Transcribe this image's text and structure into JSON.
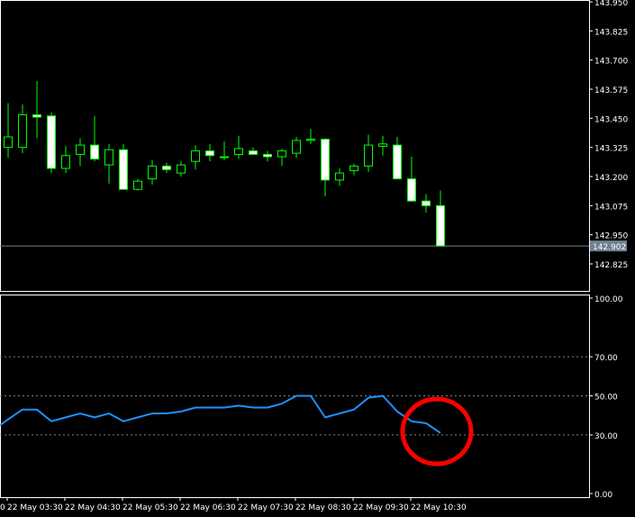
{
  "chart_data": [
    {
      "type": "candlestick",
      "title": "",
      "ylim": [
        142.77,
        143.96
      ],
      "y_ticks": [
        143.95,
        143.825,
        143.7,
        143.575,
        143.45,
        143.325,
        143.2,
        143.075,
        142.95,
        142.825
      ],
      "y_tick_labels": [
        "143.950",
        "143.825",
        "143.700",
        "143.575",
        "143.450",
        "143.325",
        "143.200",
        "143.075",
        "142.950",
        "142.825"
      ],
      "current_price": 142.902,
      "current_price_label": "142.902",
      "candles": [
        {
          "o": 143.325,
          "h": 143.515,
          "l": 143.28,
          "c": 143.37
        },
        {
          "o": 143.325,
          "h": 143.51,
          "l": 143.3,
          "c": 143.465
        },
        {
          "o": 143.465,
          "h": 143.61,
          "l": 143.365,
          "c": 143.455
        },
        {
          "o": 143.46,
          "h": 143.475,
          "l": 143.215,
          "c": 143.235
        },
        {
          "o": 143.235,
          "h": 143.33,
          "l": 143.215,
          "c": 143.29
        },
        {
          "o": 143.295,
          "h": 143.365,
          "l": 143.245,
          "c": 143.335
        },
        {
          "o": 143.335,
          "h": 143.46,
          "l": 143.265,
          "c": 143.275
        },
        {
          "o": 143.25,
          "h": 143.34,
          "l": 143.17,
          "c": 143.315
        },
        {
          "o": 143.315,
          "h": 143.34,
          "l": 143.145,
          "c": 143.145
        },
        {
          "o": 143.145,
          "h": 143.19,
          "l": 143.14,
          "c": 143.18
        },
        {
          "o": 143.19,
          "h": 143.27,
          "l": 143.165,
          "c": 143.245
        },
        {
          "o": 143.245,
          "h": 143.26,
          "l": 143.215,
          "c": 143.23
        },
        {
          "o": 143.215,
          "h": 143.265,
          "l": 143.2,
          "c": 143.25
        },
        {
          "o": 143.265,
          "h": 143.335,
          "l": 143.23,
          "c": 143.31
        },
        {
          "o": 143.31,
          "h": 143.34,
          "l": 143.265,
          "c": 143.29
        },
        {
          "o": 143.285,
          "h": 143.35,
          "l": 143.27,
          "c": 143.285
        },
        {
          "o": 143.295,
          "h": 143.375,
          "l": 143.275,
          "c": 143.32
        },
        {
          "o": 143.31,
          "h": 143.325,
          "l": 143.295,
          "c": 143.295
        },
        {
          "o": 143.295,
          "h": 143.31,
          "l": 143.265,
          "c": 143.285
        },
        {
          "o": 143.285,
          "h": 143.32,
          "l": 143.245,
          "c": 143.31
        },
        {
          "o": 143.3,
          "h": 143.37,
          "l": 143.28,
          "c": 143.355
        },
        {
          "o": 143.355,
          "h": 143.405,
          "l": 143.34,
          "c": 143.36
        },
        {
          "o": 143.36,
          "h": 143.365,
          "l": 143.115,
          "c": 143.185
        },
        {
          "o": 143.185,
          "h": 143.235,
          "l": 143.16,
          "c": 143.215
        },
        {
          "o": 143.225,
          "h": 143.255,
          "l": 143.205,
          "c": 143.245
        },
        {
          "o": 143.245,
          "h": 143.38,
          "l": 143.22,
          "c": 143.335
        },
        {
          "o": 143.33,
          "h": 143.375,
          "l": 143.29,
          "c": 143.34
        },
        {
          "o": 143.335,
          "h": 143.37,
          "l": 143.19,
          "c": 143.19
        },
        {
          "o": 143.19,
          "h": 143.285,
          "l": 143.095,
          "c": 143.095
        },
        {
          "o": 143.095,
          "h": 143.125,
          "l": 143.045,
          "c": 143.075
        },
        {
          "o": 143.075,
          "h": 143.14,
          "l": 142.902,
          "c": 142.902
        }
      ],
      "indicator": {
        "ylim": [
          0,
          100
        ],
        "levels": [
          70,
          50,
          30
        ],
        "y_ticks": [
          100,
          70,
          50,
          30,
          0
        ],
        "y_tick_labels": [
          "100.00",
          "70.00",
          "50.00",
          "30.00",
          "0.00"
        ],
        "values": [
          38,
          43,
          43,
          37,
          39,
          41,
          39,
          41,
          37,
          39,
          41,
          41,
          42,
          44,
          44,
          44,
          45,
          44,
          44,
          46,
          50,
          50,
          39,
          41,
          43,
          49,
          50,
          42,
          37,
          36,
          31
        ],
        "line_color": "#1e90ff"
      },
      "x_tick_labels": [
        "22 May 03:30",
        "22 May 04:30",
        "22 May 05:30",
        "22 May 06:30",
        "22 May 07:30",
        "22 May 08:30",
        "22 May 09:30",
        "22 May 10:30"
      ],
      "x_tick_first_partial": "0",
      "colors": {
        "background": "#000000",
        "bull_body": "#000000",
        "bear_body": "#ffffff",
        "wick": "#00ff00",
        "price_line": "#708090",
        "grid_dash": "#808080",
        "axis_text": "#ffffff",
        "annotation_circle": "#ff0000"
      }
    }
  ]
}
